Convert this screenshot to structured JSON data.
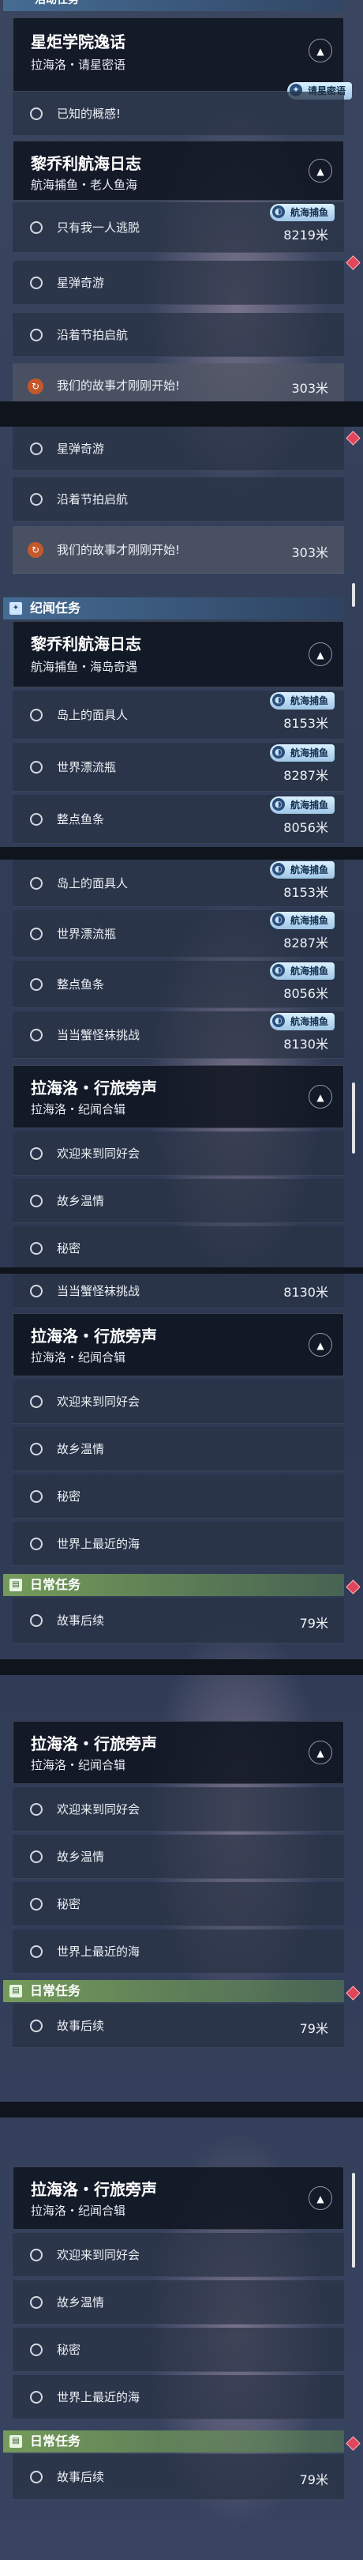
{
  "tags": {
    "hanghai": "航海捕鱼",
    "zhuixing": "请星密语"
  },
  "sections": {
    "activity": "活动任务",
    "jiwen": "纪闻任务",
    "daily": "日常任务"
  },
  "quests": {
    "xingju": {
      "title": "星炬学院逸话",
      "subtitle": "拉海洛・请星密语",
      "tasks": [
        "已知的概感!"
      ]
    },
    "liqiao_a": {
      "title": "黎乔利航海日志",
      "subtitle": "航海捕鱼・老人鱼海",
      "tasks": [
        {
          "label": "只有我一人逃脱",
          "dist": "8219米"
        },
        {
          "label": "星弹奇游"
        },
        {
          "label": "沿着节拍启航"
        }
      ]
    },
    "story_task": {
      "label": "我们的故事才刚刚开始!",
      "dist": "303米"
    },
    "liqiao_b": {
      "title": "黎乔利航海日志",
      "subtitle": "航海捕鱼・海岛奇遇",
      "tasks": [
        {
          "label": "岛上的面具人",
          "dist": "8153米"
        },
        {
          "label": "世界漂流瓶",
          "dist": "8287米"
        },
        {
          "label": "整点鱼条",
          "dist": "8056米"
        },
        {
          "label": "当当蟹怪袜挑战",
          "dist": "8130米"
        }
      ]
    },
    "haiyang": {
      "title": "拉海洛・行旅旁声",
      "subtitle": "拉海洛・纪闻合辑",
      "tasks": [
        "欢迎来到同好会",
        "故乡温情",
        "秘密",
        "世界上最近的海"
      ]
    },
    "daily_task": {
      "label": "故事后续",
      "dist": "79米"
    }
  },
  "colors": {
    "orange_icon": "#c4582b",
    "pink_marker": "#e0455b",
    "section_blue": "#466e96",
    "section_green": "#78a05a"
  }
}
